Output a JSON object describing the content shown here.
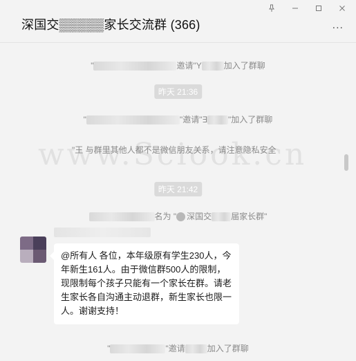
{
  "window": {
    "title": "深国交▒▒▒▒▒家长交流群 (366)",
    "controls": {
      "pin": "pin-icon",
      "minimize": "minimize-icon",
      "maximize": "maximize-icon",
      "close": "close-icon"
    },
    "more_label": "..."
  },
  "messages": {
    "sys1": {
      "prefix": "\"",
      "mid": "邀请\"Y",
      "suffix": "加入了群聊"
    },
    "time1": "昨天 21:36",
    "sys2": {
      "prefix": "\"",
      "mid": "\"邀请\"∃",
      "suffix": "\"加入了群聊"
    },
    "notice": "\"王     与群里其他人都不是微信朋友关系，请注意隐私安全",
    "time2": "昨天 21:42",
    "rename": {
      "mid": "名为 \"",
      "badge": "深国交",
      "suffix": "届家长群\""
    },
    "bubble_text": "@所有人 各位，本年级原有学生230人，今年新生161人。由于微信群500人的限制，现限制每个孩子只能有一个家长在群。请老生家长各自沟通主动退群，新生家长也限一人。谢谢支持！",
    "sys3": {
      "prefix": "\"",
      "mid": "\"邀请",
      "suffix": "加入了群聊"
    }
  },
  "watermark": "www.Sciook.cn"
}
